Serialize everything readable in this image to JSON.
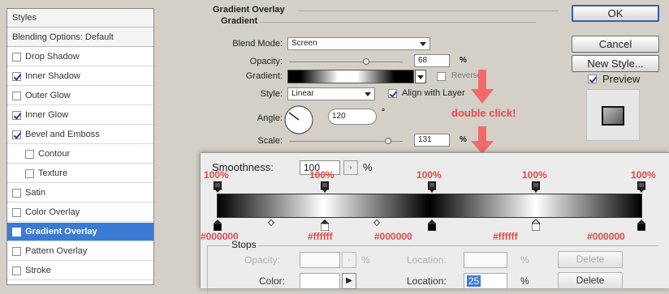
{
  "styles_panel": {
    "header": "Styles",
    "blending": "Blending Options: Default",
    "items": [
      {
        "label": "Drop Shadow",
        "checked": false
      },
      {
        "label": "Inner Shadow",
        "checked": true
      },
      {
        "label": "Outer Glow",
        "checked": false
      },
      {
        "label": "Inner Glow",
        "checked": true
      },
      {
        "label": "Bevel and Emboss",
        "checked": true
      },
      {
        "label": "Contour",
        "checked": false
      },
      {
        "label": "Texture",
        "checked": false
      },
      {
        "label": "Satin",
        "checked": false
      },
      {
        "label": "Color Overlay",
        "checked": false
      },
      {
        "label": "Gradient Overlay",
        "checked": true
      },
      {
        "label": "Pattern Overlay",
        "checked": false
      },
      {
        "label": "Stroke",
        "checked": false
      }
    ]
  },
  "overlay": {
    "title": "Gradient Overlay",
    "group": "Gradient",
    "blend_mode_label": "Blend Mode:",
    "blend_mode_value": "Screen",
    "opacity_label": "Opacity:",
    "opacity_value": "68",
    "opacity_unit": "%",
    "opacity_level": 0.68,
    "gradient_label": "Gradient:",
    "reverse_label": "Reverse",
    "style_label": "Style:",
    "style_value": "Linear",
    "align_label": "Align with Layer",
    "angle_label": "Angle:",
    "angle_value": "120",
    "angle_unit": "°",
    "scale_label": "Scale:",
    "scale_value": "131",
    "scale_unit": "%",
    "scale_level": 0.87
  },
  "buttons": {
    "ok": "OK",
    "cancel": "Cancel",
    "new_style": "New Style...",
    "preview": "Preview"
  },
  "annotation": {
    "text": "double click!",
    "color": "#e04a4a"
  },
  "editor": {
    "smoothness_label": "Smoothness:",
    "smoothness_value": "100",
    "smoothness_unit": "%",
    "opacity_stops": [
      "100%",
      "100%",
      "100%",
      "100%",
      "100%"
    ],
    "color_stops": [
      "#000000",
      "#ffffff",
      "#000000",
      "#ffffff",
      "#000000"
    ],
    "stops_title": "Stops",
    "opacity_label": "Opacity:",
    "opacity_unit": "%",
    "location_label": "Location:",
    "location_unit": "%",
    "delete_label": "Delete",
    "color_label": "Color:",
    "location2_value": "25"
  }
}
